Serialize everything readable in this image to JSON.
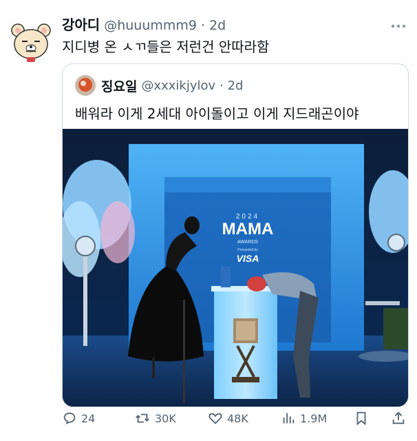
{
  "tweet": {
    "author_name": "강아디",
    "handle": "@huuummm9",
    "time": "· 2d",
    "text": "지디병 온 ㅅㄲ들은 저런건 안따라함",
    "more_icon": "more-icon"
  },
  "quote": {
    "author_name": "징요일",
    "handle": "@xxxikjylov",
    "time": "· 2d",
    "text": "배워라 이게 2세대 아이돌이고 이게 지드래곤이야",
    "media": {
      "year": "2024",
      "logo": "MAMA",
      "subtitle": "AWARDS",
      "sponsor_small": "Presented by",
      "sponsor": "VISA"
    }
  },
  "actions": {
    "replies": "24",
    "reposts": "30K",
    "likes": "48K",
    "views": "1.9M"
  },
  "colors": {
    "text": "#0f1419",
    "secondary": "#536471",
    "border": "#cfd9de",
    "stage_blue": "#2d8fe0"
  }
}
